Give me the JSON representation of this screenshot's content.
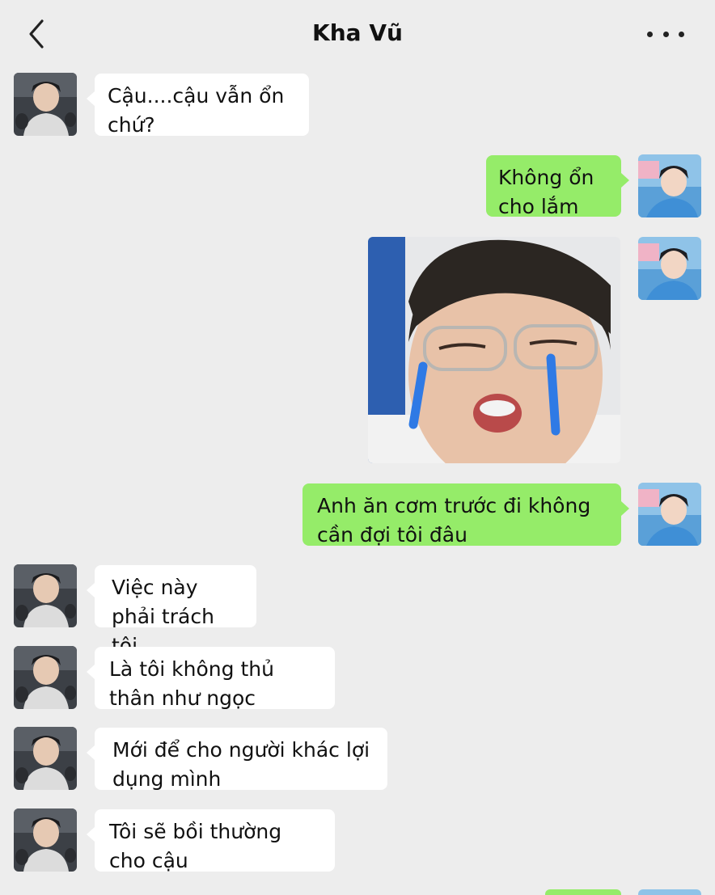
{
  "header": {
    "title": "Kha Vũ",
    "back_icon": "chevron-left-icon",
    "more_icon": "more-dots-icon"
  },
  "messages": [
    {
      "side": "in",
      "text": "Cậu....cậu vẫn ổn chứ?"
    },
    {
      "side": "out",
      "text": "Không ổn cho lắm"
    },
    {
      "side": "out",
      "type": "sticker",
      "description": "crying-face-sticker"
    },
    {
      "side": "out",
      "text": "Anh ăn cơm trước đi không cần đợi tôi đâu"
    },
    {
      "side": "in",
      "text": "Việc này phải trách tôi"
    },
    {
      "side": "in",
      "text": "Là tôi không thủ thân như ngọc"
    },
    {
      "side": "in",
      "text": "Mới để cho người khác lợi dụng mình"
    },
    {
      "side": "in",
      "text": "Tôi sẽ bồi thường cho cậu"
    }
  ],
  "colors": {
    "background": "#ededed",
    "incoming_bubble": "#ffffff",
    "outgoing_bubble": "#95ec69"
  }
}
